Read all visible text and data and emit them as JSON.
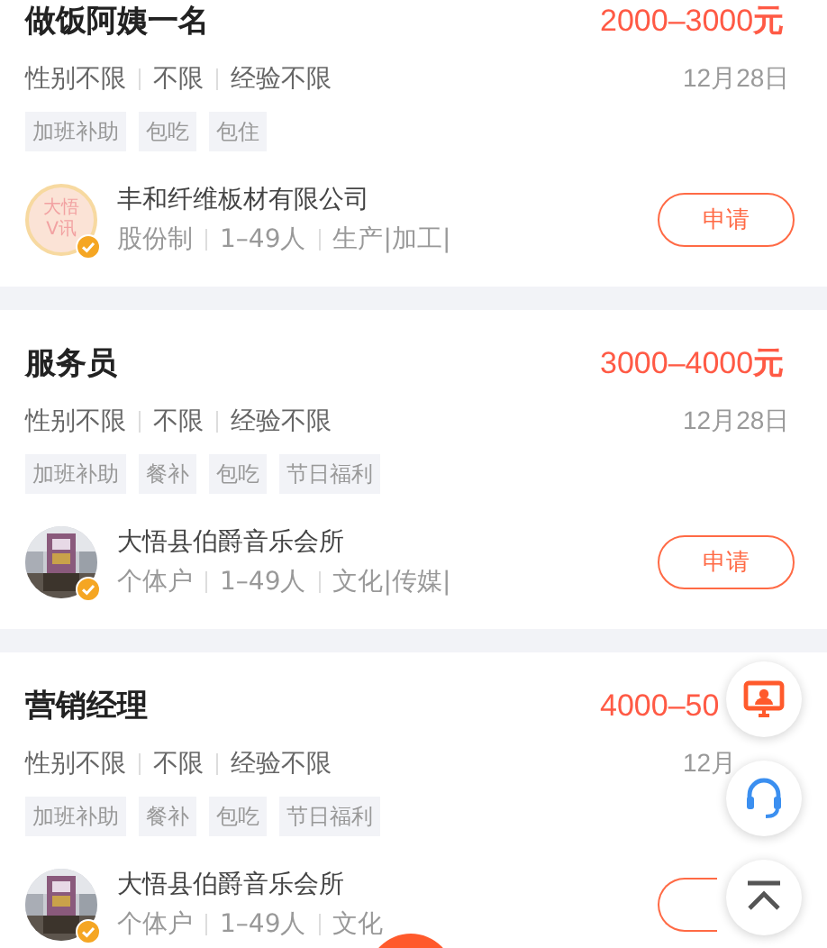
{
  "jobs": [
    {
      "title": "做饭阿姨一名",
      "salary": "2000–3000**元**",
      "requirements": [
        "性别不限",
        "不限",
        "经验不限"
      ],
      "date": "12月28日",
      "tags": [
        "加班补助",
        "包吃",
        "包住"
      ],
      "company": {
        "avatar": {
          "kind": "logo",
          "lines": [
            "大悟",
            "V讯"
          ]
        },
        "verified": true,
        "name": "丰和纤维板材有限公司",
        "details": [
          "股份制",
          "1–49人",
          "生产|加工|"
        ]
      },
      "apply": "申请"
    },
    {
      "title": "服务员",
      "salary": "3000–4000**元**",
      "requirements": [
        "性别不限",
        "不限",
        "经验不限"
      ],
      "date": "12月28日",
      "tags": [
        "加班补助",
        "餐补",
        "包吃",
        "节日福利"
      ],
      "company": {
        "avatar": {
          "kind": "picture"
        },
        "verified": true,
        "name": "大悟县伯爵音乐会所",
        "details": [
          "个体户",
          "1–49人",
          "文化|传媒|"
        ]
      },
      "apply": "申请"
    },
    {
      "title": "营销经理",
      "salary": "4000–50",
      "requirements": [
        "性别不限",
        "不限",
        "经验不限"
      ],
      "date": "12月",
      "tags": [
        "加班补助",
        "餐补",
        "包吃",
        "节日福利"
      ],
      "company": {
        "avatar": {
          "kind": "picture"
        },
        "verified": true,
        "name": "大悟县伯爵音乐会所",
        "details": [
          "个体户",
          "1–49人",
          "文化"
        ]
      }
    }
  ],
  "floating_buttons": [
    {
      "kind": "monitor"
    },
    {
      "kind": "headset"
    },
    {
      "kind": "top"
    }
  ],
  "bottom_button": {
    "kind": "orange"
  }
}
